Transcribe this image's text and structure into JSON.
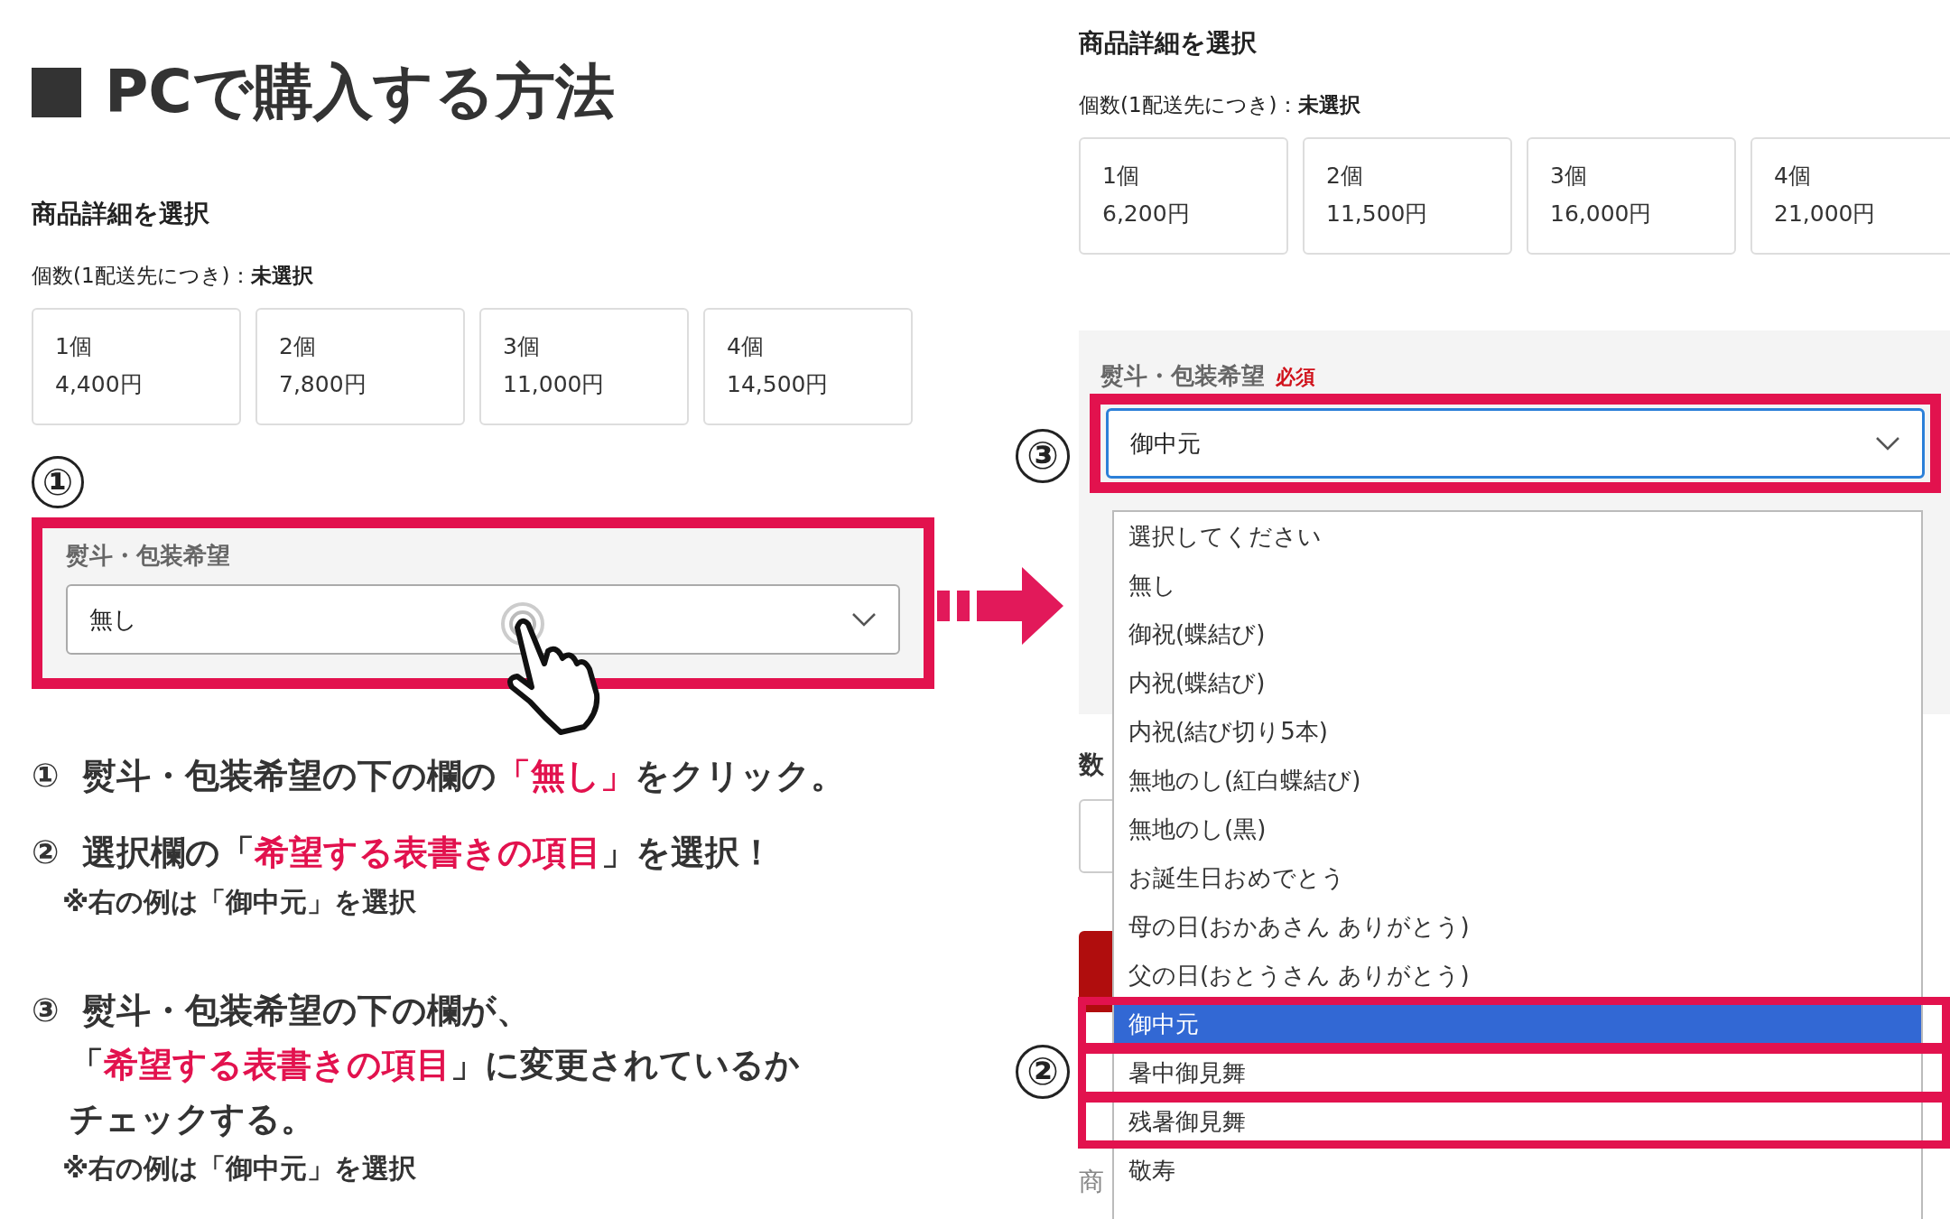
{
  "title": "PCで購入する方法",
  "left": {
    "heading": "商品詳細を選択",
    "quantity_label": "個数(1配送先につき)：**未選択**",
    "options": [
      {
        "count": "1個",
        "price": "4,400円"
      },
      {
        "count": "2個",
        "price": "7,800円"
      },
      {
        "count": "3個",
        "price": "11,000円"
      },
      {
        "count": "4個",
        "price": "14,500円"
      }
    ],
    "step_marker": "①",
    "field": {
      "label": "熨斗・包装希望",
      "value": "無し"
    }
  },
  "instructions": [
    {
      "marker": "①",
      "lines": [
        "熨斗・包装希望の下の欄の**「無し」**をクリック。"
      ]
    },
    {
      "marker": "②",
      "lines": [
        "選択欄の「**希望する表書きの項目**」を選択！"
      ],
      "note": "※右の例は「御中元」を選択"
    },
    {
      "marker": "③",
      "lines": [
        "熨斗・包装希望の下の欄が、",
        "「**希望する表書きの項目**」に変更されているか",
        "チェックする。"
      ],
      "note": "※右の例は「御中元」を選択"
    }
  ],
  "right": {
    "heading": "商品詳細を選択",
    "quantity_label": "個数(1配送先につき)：**未選択**",
    "options": [
      {
        "count": "1個",
        "price": "6,200円"
      },
      {
        "count": "2個",
        "price": "11,500円"
      },
      {
        "count": "3個",
        "price": "16,000円"
      },
      {
        "count": "4個",
        "price": "21,000円"
      }
    ],
    "field": {
      "label": "熨斗・包装希望",
      "required": "必須",
      "value": "御中元"
    },
    "select_marker": "③",
    "options_marker": "②",
    "dropdown": [
      {
        "label": "選択してください",
        "selected": false,
        "highlighted": false
      },
      {
        "label": "無し",
        "selected": false,
        "highlighted": false
      },
      {
        "label": "御祝(蝶結び)",
        "selected": false,
        "highlighted": false
      },
      {
        "label": "内祝(蝶結び)",
        "selected": false,
        "highlighted": false
      },
      {
        "label": "内祝(結び切り5本)",
        "selected": false,
        "highlighted": false
      },
      {
        "label": "無地のし(紅白蝶結び)",
        "selected": false,
        "highlighted": false
      },
      {
        "label": "無地のし(黒)",
        "selected": false,
        "highlighted": false
      },
      {
        "label": "お誕生日おめでとう",
        "selected": false,
        "highlighted": false
      },
      {
        "label": "母の日(おかあさん ありがとう)",
        "selected": false,
        "highlighted": false
      },
      {
        "label": "父の日(おとうさん ありがとう)",
        "selected": false,
        "highlighted": false
      },
      {
        "label": "御中元",
        "selected": true,
        "highlighted": true
      },
      {
        "label": "暑中御見舞",
        "selected": false,
        "highlighted": true
      },
      {
        "label": "残暑御見舞",
        "selected": false,
        "highlighted": true
      },
      {
        "label": "敬寿",
        "selected": false,
        "highlighted": false
      }
    ],
    "background_texts": [
      "数",
      "商"
    ]
  }
}
